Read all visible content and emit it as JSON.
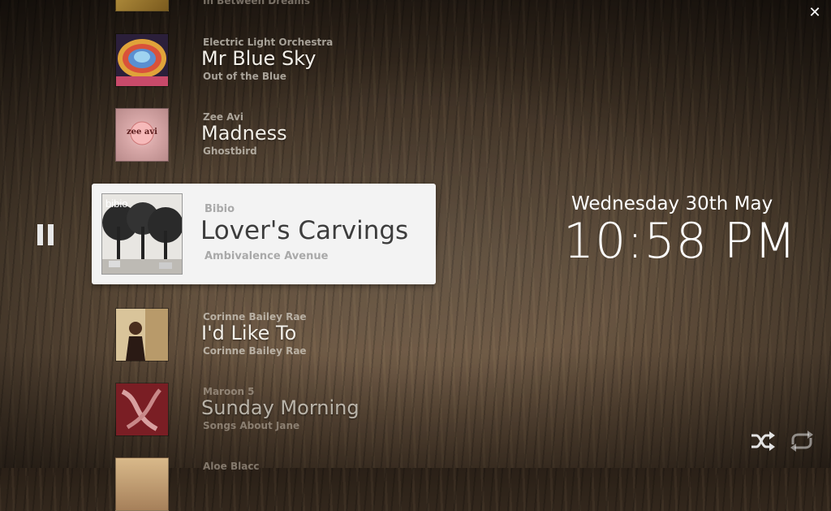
{
  "playlist": {
    "tracks": [
      {
        "artist": "",
        "title": "",
        "album": "In Between Dreams"
      },
      {
        "artist": "Electric Light Orchestra",
        "title": "Mr Blue Sky",
        "album": "Out of the Blue"
      },
      {
        "artist": "Zee Avi",
        "title": "Madness",
        "album": "Ghostbird",
        "art_text": "zee avi"
      },
      {
        "artist": "Corinne Bailey Rae",
        "title": "I'd Like To",
        "album": "Corinne Bailey Rae"
      },
      {
        "artist": "Maroon 5",
        "title": "Sunday Morning",
        "album": "Songs About Jane"
      },
      {
        "artist": "Aloe Blacc",
        "title": "",
        "album": ""
      }
    ]
  },
  "now_playing": {
    "artist": "Bibio",
    "title": "Lover's Carvings",
    "album": "Ambivalence Avenue",
    "art_text": "bibio"
  },
  "clock": {
    "date": "Wednesday 30th May",
    "time": "10:58 PM"
  },
  "controls": {
    "close_glyph": "✕",
    "icons": [
      "close-icon",
      "pause-icon",
      "shuffle-icon",
      "repeat-icon"
    ]
  },
  "colors": {
    "highlight_bg": "#f3f3f3",
    "title_text": "#3d3d3d",
    "meta_text": "#a9a9a9"
  }
}
